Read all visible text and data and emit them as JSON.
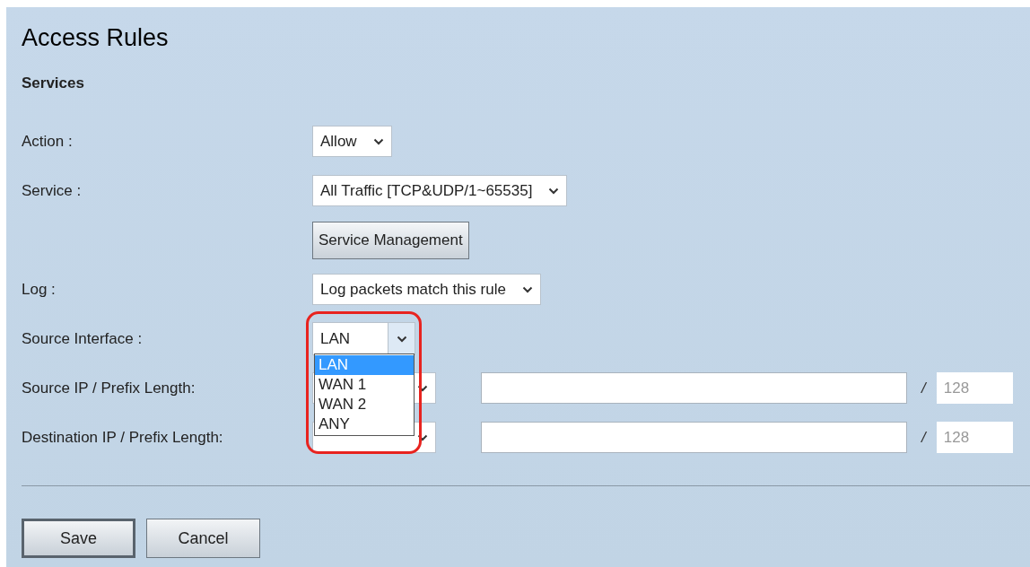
{
  "title": "Access Rules",
  "section": "Services",
  "rows": [
    {
      "kind": "select",
      "label": "Action :",
      "value": "Allow"
    },
    {
      "kind": "select",
      "label": "Service :",
      "value": "All Traffic [TCP&UDP/1~65535]"
    },
    {
      "kind": "button",
      "label": "Service Management"
    },
    {
      "kind": "select",
      "label": "Log :",
      "value": "Log packets match this rule"
    },
    {
      "kind": "dropdown",
      "label": "Source Interface :",
      "value": "LAN",
      "highlighted": true,
      "options": [
        {
          "label": "LAN",
          "selected": true
        },
        {
          "label": "WAN 1",
          "selected": false
        },
        {
          "label": "WAN 2",
          "selected": false
        },
        {
          "label": "ANY",
          "selected": false
        }
      ]
    },
    {
      "kind": "ip",
      "label": "Source IP / Prefix Length:",
      "separator": "/",
      "placeholder": "128"
    },
    {
      "kind": "ip",
      "label": "Destination IP / Prefix Length:",
      "separator": "/",
      "placeholder": "128"
    }
  ],
  "buttons": [
    {
      "label": "Save",
      "focused": true
    },
    {
      "label": "Cancel",
      "focused": false
    }
  ]
}
